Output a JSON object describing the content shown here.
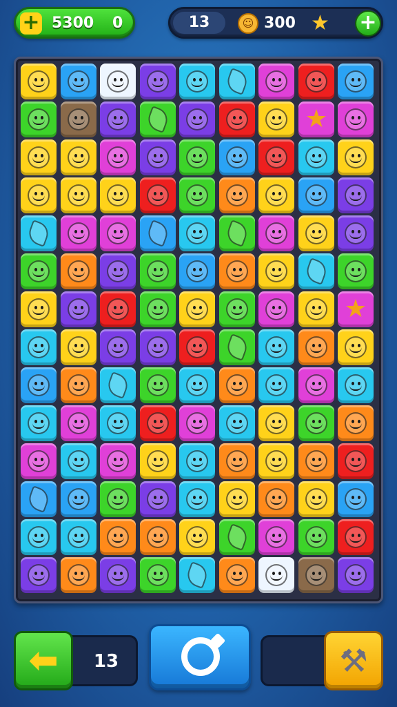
{
  "header": {
    "score_value": "5300",
    "score_extra": "0",
    "moves": "13",
    "coins": "300"
  },
  "bottom": {
    "moves_left": "13"
  },
  "icons": {
    "add_score": "plus-icon",
    "coin": "coin-icon",
    "star": "star-icon",
    "add": "plus-circle-icon",
    "back": "arrow-left-icon",
    "shuffle": "refresh-icon",
    "hammer": "hammer-icon"
  },
  "colors": {
    "Y": "#ffd21a",
    "B": "#2aa3f5",
    "C": "#28c8ef",
    "G": "#3dd42a",
    "O": "#ff8a1a",
    "R": "#ee1f1f",
    "P": "#e040d8",
    "V": "#7b3ee6",
    "W": "#eef6ff",
    "N": "#8a6a4a"
  },
  "grid": {
    "rows": [
      [
        "Y-face",
        "B-face",
        "W-face",
        "V-face",
        "C-face",
        "C-leaf",
        "P-face",
        "R-face",
        "B-face"
      ],
      [
        "G-face",
        "N-face",
        "V-face",
        "G-leaf",
        "V-face",
        "R-face",
        "Y-face",
        "P-star",
        "P-face"
      ],
      [
        "Y-face",
        "Y-face",
        "P-face",
        "V-face",
        "G-face",
        "B-face",
        "R-face",
        "C-face",
        "Y-face"
      ],
      [
        "Y-face",
        "Y-face",
        "Y-face",
        "R-face",
        "G-face",
        "O-face",
        "Y-face",
        "B-face",
        "V-face"
      ],
      [
        "C-leaf",
        "P-face",
        "P-face",
        "B-leaf",
        "C-face",
        "G-leaf",
        "P-face",
        "Y-face",
        "V-face"
      ],
      [
        "G-face",
        "O-face",
        "V-face",
        "G-face",
        "B-face",
        "O-face",
        "Y-face",
        "C-leaf",
        "G-face"
      ],
      [
        "Y-face",
        "V-face",
        "R-face",
        "G-face",
        "Y-face",
        "G-face",
        "P-face",
        "Y-face",
        "P-star"
      ],
      [
        "C-face",
        "Y-face",
        "V-face",
        "V-face",
        "R-face",
        "G-leaf",
        "C-face",
        "O-face",
        "Y-face"
      ],
      [
        "B-face",
        "O-face",
        "C-leaf",
        "G-face",
        "C-face",
        "O-face",
        "C-face",
        "P-face",
        "C-face"
      ],
      [
        "C-face",
        "P-face",
        "C-face",
        "R-face",
        "P-face",
        "C-face",
        "Y-face",
        "G-face",
        "O-face"
      ],
      [
        "P-face",
        "C-face",
        "P-face",
        "Y-face",
        "C-face",
        "O-face",
        "Y-face",
        "O-face",
        "R-face"
      ],
      [
        "B-leaf",
        "B-face",
        "G-face",
        "V-face",
        "C-face",
        "Y-face",
        "O-face",
        "Y-face",
        "B-face"
      ],
      [
        "C-face",
        "C-face",
        "O-face",
        "O-face",
        "Y-face",
        "G-leaf",
        "P-face",
        "G-face",
        "R-face"
      ],
      [
        "V-face",
        "O-face",
        "V-face",
        "G-face",
        "C-leaf",
        "O-face",
        "W-face",
        "N-face",
        "V-face"
      ]
    ]
  }
}
